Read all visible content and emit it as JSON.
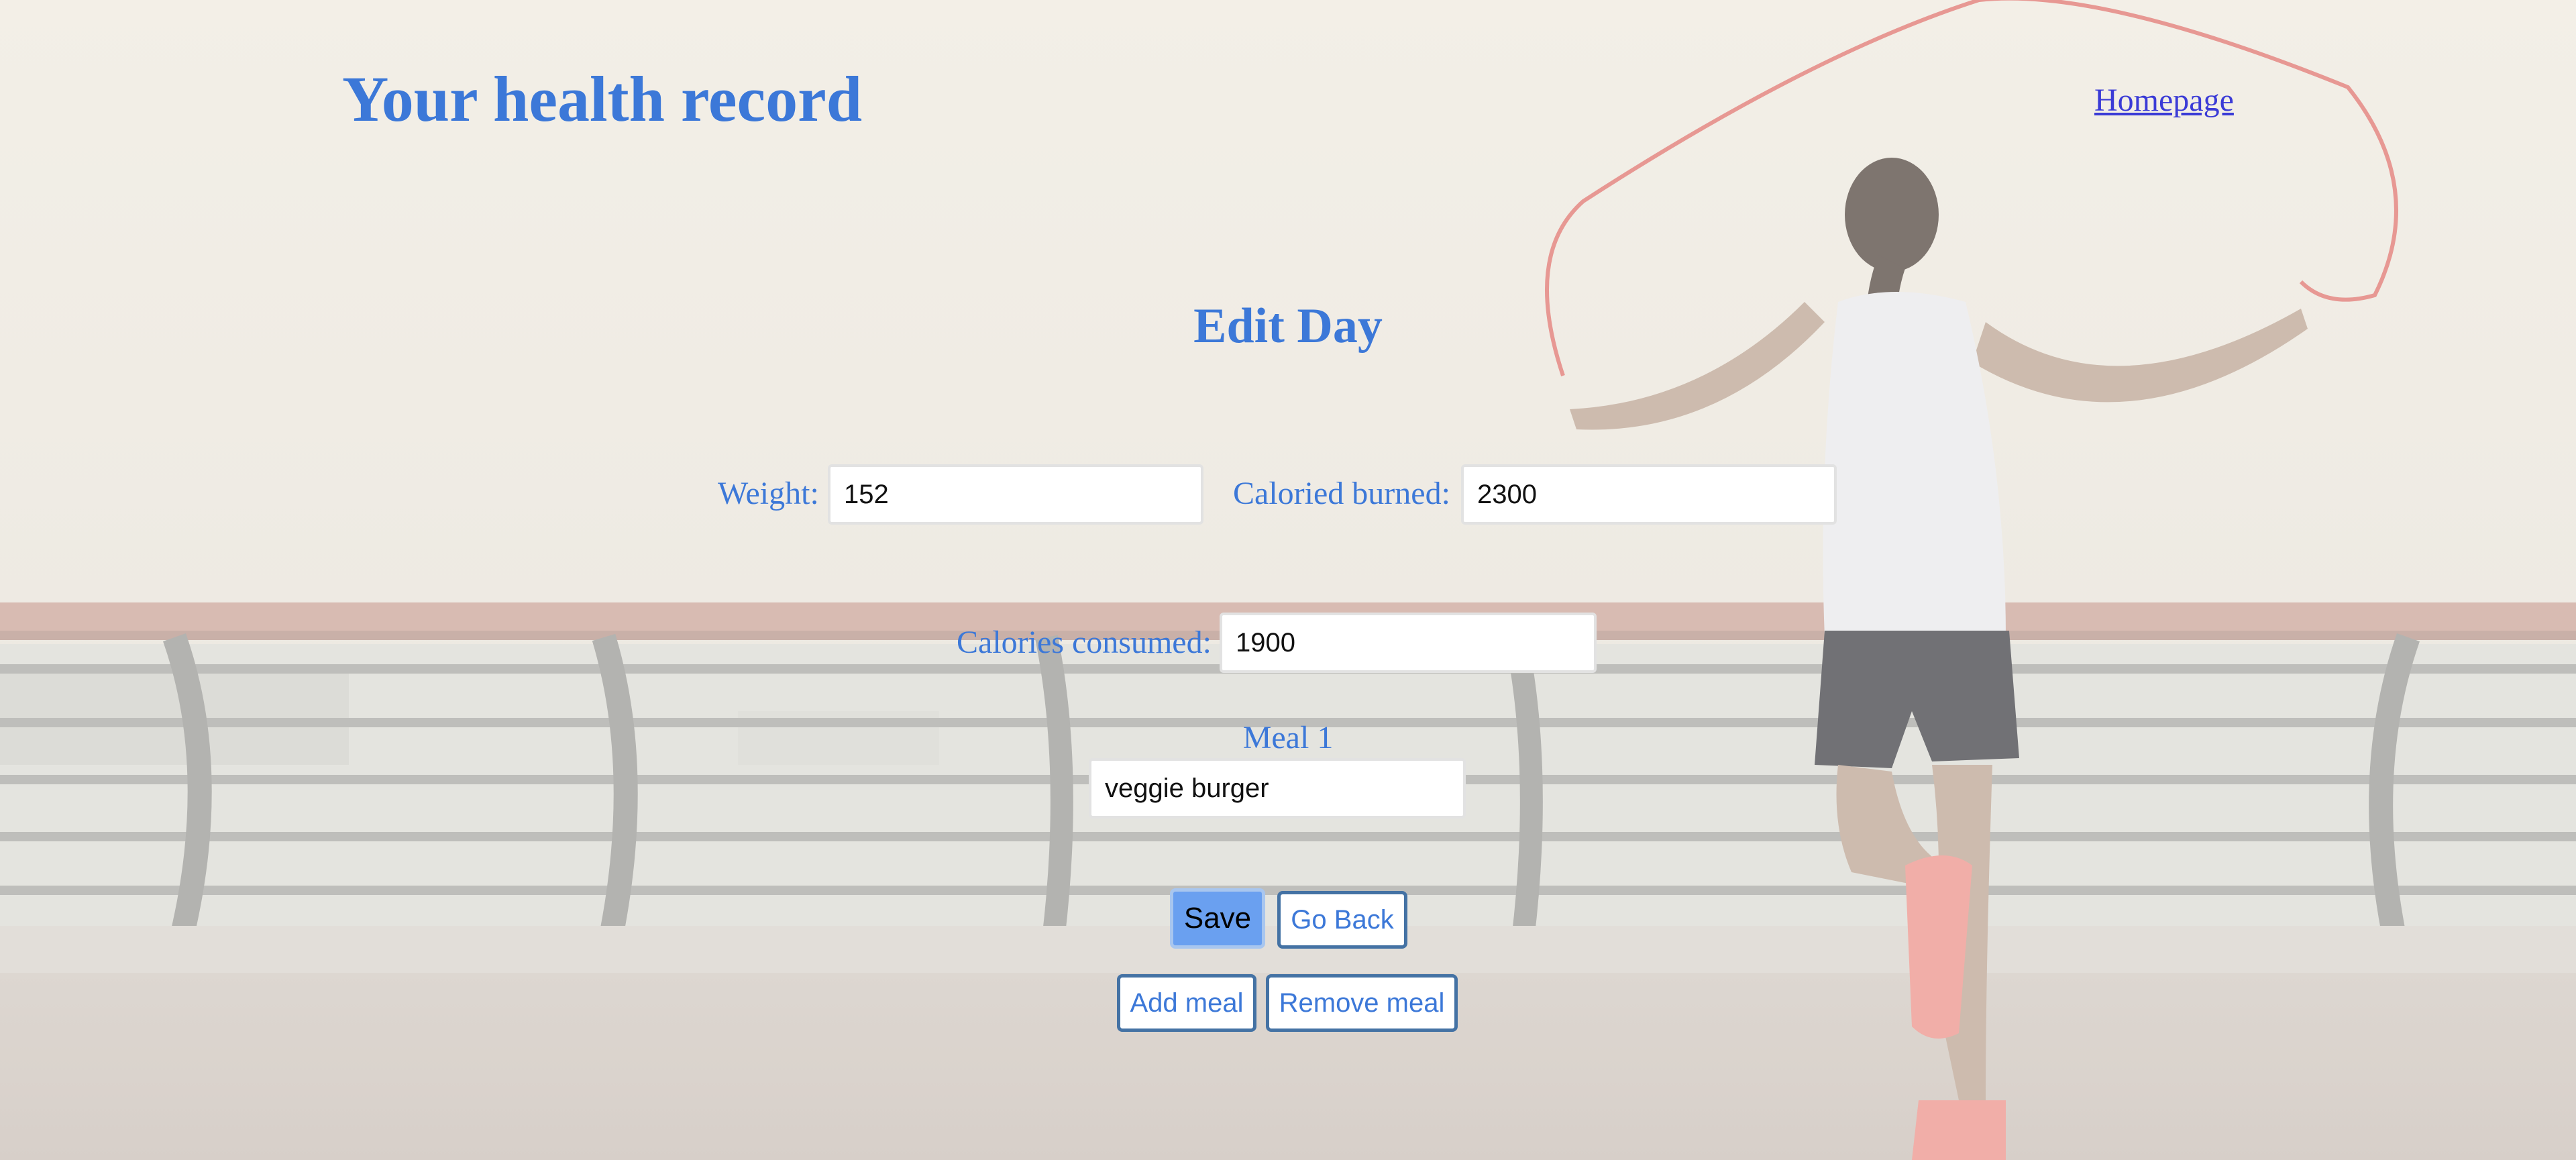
{
  "site_title": "Your health record",
  "nav": {
    "homepage_label": "Homepage"
  },
  "page_title": "Edit Day",
  "form": {
    "weight_label": "Weight:",
    "weight_value": "152",
    "burned_label": "Caloried burned:",
    "burned_value": "2300",
    "consumed_label": "Calories consumed:",
    "consumed_value": "1900",
    "meals": [
      {
        "label": "Meal 1",
        "value": "veggie burger"
      }
    ]
  },
  "buttons": {
    "save": "Save",
    "go_back": "Go Back",
    "add_meal": "Add meal",
    "remove_meal": "Remove meal"
  },
  "colors": {
    "accent": "#3c78d8",
    "link": "#3b3bd6",
    "save_button": "#6aa0f0",
    "button_border": "#4472a4"
  },
  "background_image": "woman-jumping-rope-on-waterfront-promenade"
}
